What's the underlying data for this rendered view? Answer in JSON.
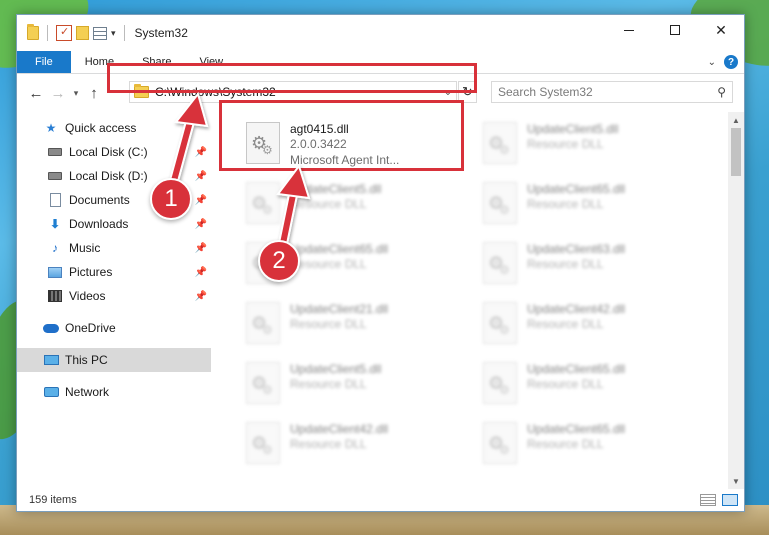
{
  "window": {
    "title": "System32",
    "controls": {
      "minimize": "",
      "maximize": "",
      "close": "✕"
    }
  },
  "ribbon": {
    "tabs": [
      "File",
      "Home",
      "Share",
      "View"
    ]
  },
  "address_bar": {
    "path": "C:\\Windows\\System32",
    "search_placeholder": "Search System32"
  },
  "sidebar": {
    "quick_access": "Quick access",
    "items": [
      {
        "label": "Local Disk (C:)",
        "icon": "drive-icon"
      },
      {
        "label": "Local Disk (D:)",
        "icon": "drive-icon"
      },
      {
        "label": "Documents",
        "icon": "documents-icon"
      },
      {
        "label": "Downloads",
        "icon": "downloads-icon"
      },
      {
        "label": "Music",
        "icon": "music-icon"
      },
      {
        "label": "Pictures",
        "icon": "pictures-icon"
      },
      {
        "label": "Videos",
        "icon": "videos-icon"
      }
    ],
    "onedrive": "OneDrive",
    "this_pc": "This PC",
    "network": "Network"
  },
  "files": {
    "highlighted": {
      "name": "agt0415.dll",
      "version": "2.0.0.3422",
      "description": "Microsoft Agent Int..."
    },
    "others": [
      {
        "name": "UpdateClient5.dll",
        "type": "Resource DLL"
      },
      {
        "name": "UpdateClient5.dll",
        "type": "Resource DLL"
      },
      {
        "name": "UpdateClient65.dll",
        "type": "Resource DLL"
      },
      {
        "name": "UpdateClient65.dll",
        "type": "Resource DLL"
      },
      {
        "name": "UpdateClient63.dll",
        "type": "Resource DLL"
      },
      {
        "name": "UpdateClient21.dll",
        "type": "Resource DLL"
      },
      {
        "name": "UpdateClient42.dll",
        "type": "Resource DLL"
      },
      {
        "name": "UpdateClient5.dll",
        "type": "Resource DLL"
      },
      {
        "name": "UpdateClient65.dll",
        "type": "Resource DLL"
      },
      {
        "name": "UpdateClient42.dll",
        "type": "Resource DLL"
      },
      {
        "name": "UpdateClient65.dll",
        "type": "Resource DLL"
      }
    ]
  },
  "status": {
    "item_count": "159 items"
  },
  "callouts": {
    "step1": "1",
    "step2": "2"
  },
  "colors": {
    "highlight": "#d8313a",
    "accent": "#1979ca"
  }
}
